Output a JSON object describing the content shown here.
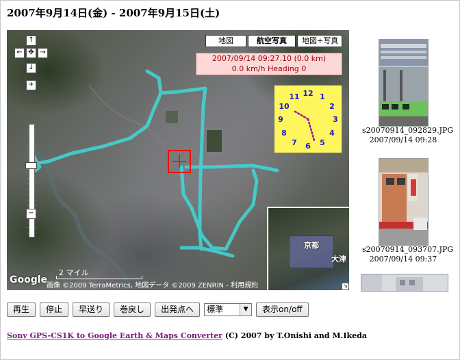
{
  "page": {
    "title": "2007年9月14日(金) - 2007年9月15日(土)"
  },
  "map": {
    "type_buttons": [
      "地図",
      "航空写真",
      "地図+写真"
    ],
    "active_type": "航空写真",
    "info": {
      "line1": "2007/09/14 09:27.10 (0.0 km)",
      "line2": "0.0 km/h   Heading 0"
    },
    "clock": {
      "numbers": [
        "12",
        "1",
        "2",
        "3",
        "4",
        "5",
        "6",
        "7",
        "8",
        "9",
        "10",
        "11"
      ],
      "time": "09:27"
    },
    "overview": {
      "label_city": "京都",
      "label_other": "大津",
      "corner_icon": "resize-corner-icon"
    },
    "scale_label": "2 マイル",
    "google_logo": "Google",
    "copyright": "画像 ©2009 TerraMetrics, 地図データ ©2009 ZENRIN - 利用規約",
    "nav_icons": {
      "up": "↑",
      "left": "←",
      "center": "✥",
      "right": "→",
      "down": "↓",
      "zoom_in": "+",
      "zoom_out": "−"
    },
    "colors": {
      "track": "#3fd9d9",
      "marker": "#ff0000",
      "clock_bg": "#fff65e",
      "info_bg": "#fdd8d8"
    }
  },
  "photos": [
    {
      "filename": "s20070914_092829.JPG",
      "datetime": "2007/09/14 09:28"
    },
    {
      "filename": "s20070914_093707.JPG",
      "datetime": "2007/09/14 09:37"
    }
  ],
  "controls": {
    "buttons": [
      "再生",
      "停止",
      "早送り",
      "巻戻し",
      "出発点へ"
    ],
    "speed_select": "標準",
    "toggle_button": "表示on/off"
  },
  "footer": {
    "link_text": "Sony GPS-CS1K to Google Earth & Maps Converter",
    "suffix": " (C) 2007 by T.Onishi and M.Ikeda"
  }
}
